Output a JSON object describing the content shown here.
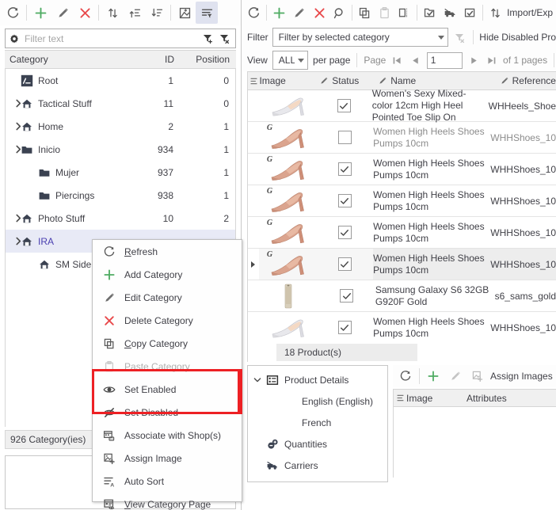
{
  "left": {
    "toolbar": [
      {
        "name": "refresh",
        "icon": "refresh-icon"
      },
      {
        "name": "add",
        "icon": "plus-icon"
      },
      {
        "name": "edit",
        "icon": "pencil-icon"
      },
      {
        "name": "delete",
        "icon": "x-icon"
      },
      {
        "name": "sort-updown",
        "icon": "sort-updown-icon"
      },
      {
        "name": "move-up",
        "icon": "move-up-icon"
      },
      {
        "name": "sort-descending",
        "icon": "sort-descending-icon"
      },
      {
        "name": "toggle-image",
        "icon": "image-toggle-icon"
      },
      {
        "name": "filter-view",
        "icon": "filter-list-icon"
      }
    ],
    "filter_placeholder": "Filter text",
    "columns": {
      "category": "Category",
      "id": "ID",
      "position": "Position"
    },
    "rows": [
      {
        "label": "Root",
        "id": "1",
        "position": "0",
        "icon": "root-icon",
        "indent": 0,
        "expandable": false,
        "selected": false
      },
      {
        "label": "Tactical Stuff",
        "id": "11",
        "position": "0",
        "icon": "home-icon",
        "indent": 1,
        "expandable": true,
        "selected": false
      },
      {
        "label": "Home",
        "id": "2",
        "position": "1",
        "icon": "home-icon",
        "indent": 1,
        "expandable": true,
        "selected": false
      },
      {
        "label": "Inicio",
        "id": "934",
        "position": "1",
        "icon": "folder-icon",
        "indent": 1,
        "expandable": true,
        "selected": false
      },
      {
        "label": "Mujer",
        "id": "937",
        "position": "1",
        "icon": "folder-icon",
        "indent": 2,
        "expandable": false,
        "selected": false
      },
      {
        "label": "Piercings",
        "id": "938",
        "position": "1",
        "icon": "folder-icon",
        "indent": 2,
        "expandable": false,
        "selected": false
      },
      {
        "label": "Photo Stuff",
        "id": "10",
        "position": "2",
        "icon": "home-icon",
        "indent": 1,
        "expandable": true,
        "selected": false
      },
      {
        "label": "IRA",
        "id": "",
        "position": "",
        "icon": "home-icon",
        "indent": 1,
        "expandable": true,
        "selected": true
      },
      {
        "label": "SM Side",
        "id": "",
        "position": "",
        "icon": "home-icon",
        "indent": 2,
        "expandable": false,
        "selected": false
      }
    ],
    "status": "926 Category(ies)"
  },
  "context_menu": {
    "items": [
      {
        "label": "Refresh",
        "accel": "R",
        "icon": "refresh-icon",
        "disabled": false,
        "highlighted": false
      },
      {
        "label": "Add Category",
        "accel": "",
        "icon": "plus-icon",
        "disabled": false,
        "highlighted": false
      },
      {
        "label": "Edit Category",
        "accel": "",
        "icon": "pencil-icon",
        "disabled": false,
        "highlighted": false
      },
      {
        "label": "Delete Category",
        "accel": "",
        "icon": "x-icon",
        "disabled": false,
        "highlighted": false
      },
      {
        "label": "Copy Category",
        "accel": "C",
        "icon": "copy-icon",
        "disabled": false,
        "highlighted": false
      },
      {
        "label": "Paste Category",
        "accel": "P",
        "icon": "paste-icon",
        "disabled": true,
        "highlighted": false
      },
      {
        "label": "Set Enabled",
        "accel": "",
        "icon": "eye-icon",
        "disabled": false,
        "highlighted": true
      },
      {
        "label": "Set Disabled",
        "accel": "",
        "icon": "eye-off-icon",
        "disabled": false,
        "highlighted": true
      },
      {
        "label": "Associate with Shop(s)",
        "accel": "",
        "icon": "shop-associate-icon",
        "disabled": false,
        "highlighted": false
      },
      {
        "label": "Assign Image",
        "accel": "",
        "icon": "assign-image-icon",
        "disabled": false,
        "highlighted": false
      },
      {
        "label": "Auto Sort",
        "accel": "",
        "icon": "auto-sort-icon",
        "disabled": false,
        "highlighted": false
      },
      {
        "label": "View Category Page",
        "accel": "V",
        "icon": "view-page-icon",
        "disabled": false,
        "highlighted": false
      }
    ],
    "highlight_color": "#ed2024"
  },
  "right": {
    "toolbar": [
      {
        "name": "refresh",
        "icon": "refresh-icon"
      },
      {
        "name": "add",
        "icon": "plus-icon"
      },
      {
        "name": "edit",
        "icon": "pencil-icon"
      },
      {
        "name": "delete",
        "icon": "x-icon"
      },
      {
        "name": "search",
        "icon": "magnifier-icon"
      },
      {
        "name": "copy",
        "icon": "copy-icon"
      },
      {
        "name": "paste",
        "icon": "paste-icon"
      },
      {
        "name": "duplicate",
        "icon": "duplicate-icon"
      },
      {
        "name": "assign-category",
        "icon": "category-check-icon"
      },
      {
        "name": "assign-carrier",
        "icon": "carrier-check-icon"
      },
      {
        "name": "assign-feature",
        "icon": "feature-check-icon"
      },
      {
        "name": "import-export",
        "icon": "import-export-icon"
      }
    ],
    "import_export_label": "Import/Exp",
    "filter": {
      "label": "Filter",
      "value": "Filter by selected category",
      "clear_icon": "clear-filter-icon",
      "hide_disabled_label": "Hide Disabled Pro"
    },
    "paging": {
      "view_label": "View",
      "per_page_value": "ALL",
      "per_page_label": "per page",
      "page_label": "Page",
      "page_value": "1",
      "of_pages": "of 1 pages"
    },
    "grid": {
      "columns": {
        "image": "Image",
        "status": "Status",
        "name": "Name",
        "reference": "Reference"
      },
      "rows": [
        {
          "name": "Women's Sexy Mixed-color 12cm High Heel Pointed Toe Slip On",
          "reference": "WHHeels_Shoe",
          "checked": true,
          "dimmed": false,
          "selected": false,
          "thumb": "silver-heel",
          "badge": ""
        },
        {
          "name": "Women High Heels Shoes Pumps 10cm",
          "reference": "WHHShoes_10",
          "checked": false,
          "dimmed": true,
          "selected": false,
          "thumb": "nude-heel",
          "badge": "G"
        },
        {
          "name": "Women High Heels Shoes Pumps 10cm",
          "reference": "WHHShoes_10",
          "checked": true,
          "dimmed": false,
          "selected": false,
          "thumb": "nude-heel",
          "badge": "G"
        },
        {
          "name": "Women High Heels Shoes Pumps 10cm",
          "reference": "WHHShoes_10",
          "checked": true,
          "dimmed": false,
          "selected": false,
          "thumb": "nude-heel",
          "badge": "G"
        },
        {
          "name": "Women High Heels Shoes Pumps 10cm",
          "reference": "WHHShoes_10",
          "checked": true,
          "dimmed": false,
          "selected": false,
          "thumb": "nude-heel",
          "badge": "G"
        },
        {
          "name": "Women High Heels Shoes Pumps 10cm",
          "reference": "WHHShoes_10",
          "checked": true,
          "dimmed": false,
          "selected": true,
          "thumb": "nude-heel",
          "badge": "G"
        },
        {
          "name": "Samsung Galaxy S6 32GB G920F Gold",
          "reference": "s6_sams_gold",
          "checked": true,
          "dimmed": false,
          "selected": false,
          "thumb": "phone-gold",
          "badge": ""
        },
        {
          "name": "Women High Heels Shoes Pumps 10cm",
          "reference": "WHHShoes_10",
          "checked": true,
          "dimmed": false,
          "selected": false,
          "thumb": "silver-heel",
          "badge": ""
        }
      ],
      "count_label": "18 Product(s)"
    },
    "details": {
      "items": [
        {
          "label": "Product Details",
          "icon": "details-icon",
          "expandable": true,
          "sub": false
        },
        {
          "label": "English (English)",
          "icon": "",
          "expandable": false,
          "sub": true
        },
        {
          "label": "French",
          "icon": "",
          "expandable": false,
          "sub": true
        },
        {
          "label": "Quantities",
          "icon": "quantities-icon",
          "expandable": false,
          "sub": false
        },
        {
          "label": "Carriers",
          "icon": "carrier-icon",
          "expandable": false,
          "sub": false
        }
      ]
    },
    "images_panel": {
      "toolbar": [
        {
          "name": "refresh",
          "icon": "refresh-icon"
        },
        {
          "name": "add",
          "icon": "plus-icon"
        },
        {
          "name": "edit",
          "icon": "pencil-icon"
        },
        {
          "name": "assign-images",
          "icon": "assign-image-icon"
        }
      ],
      "assign_label": "Assign Images",
      "columns": {
        "image": "Image",
        "attributes": "Attributes"
      }
    }
  }
}
